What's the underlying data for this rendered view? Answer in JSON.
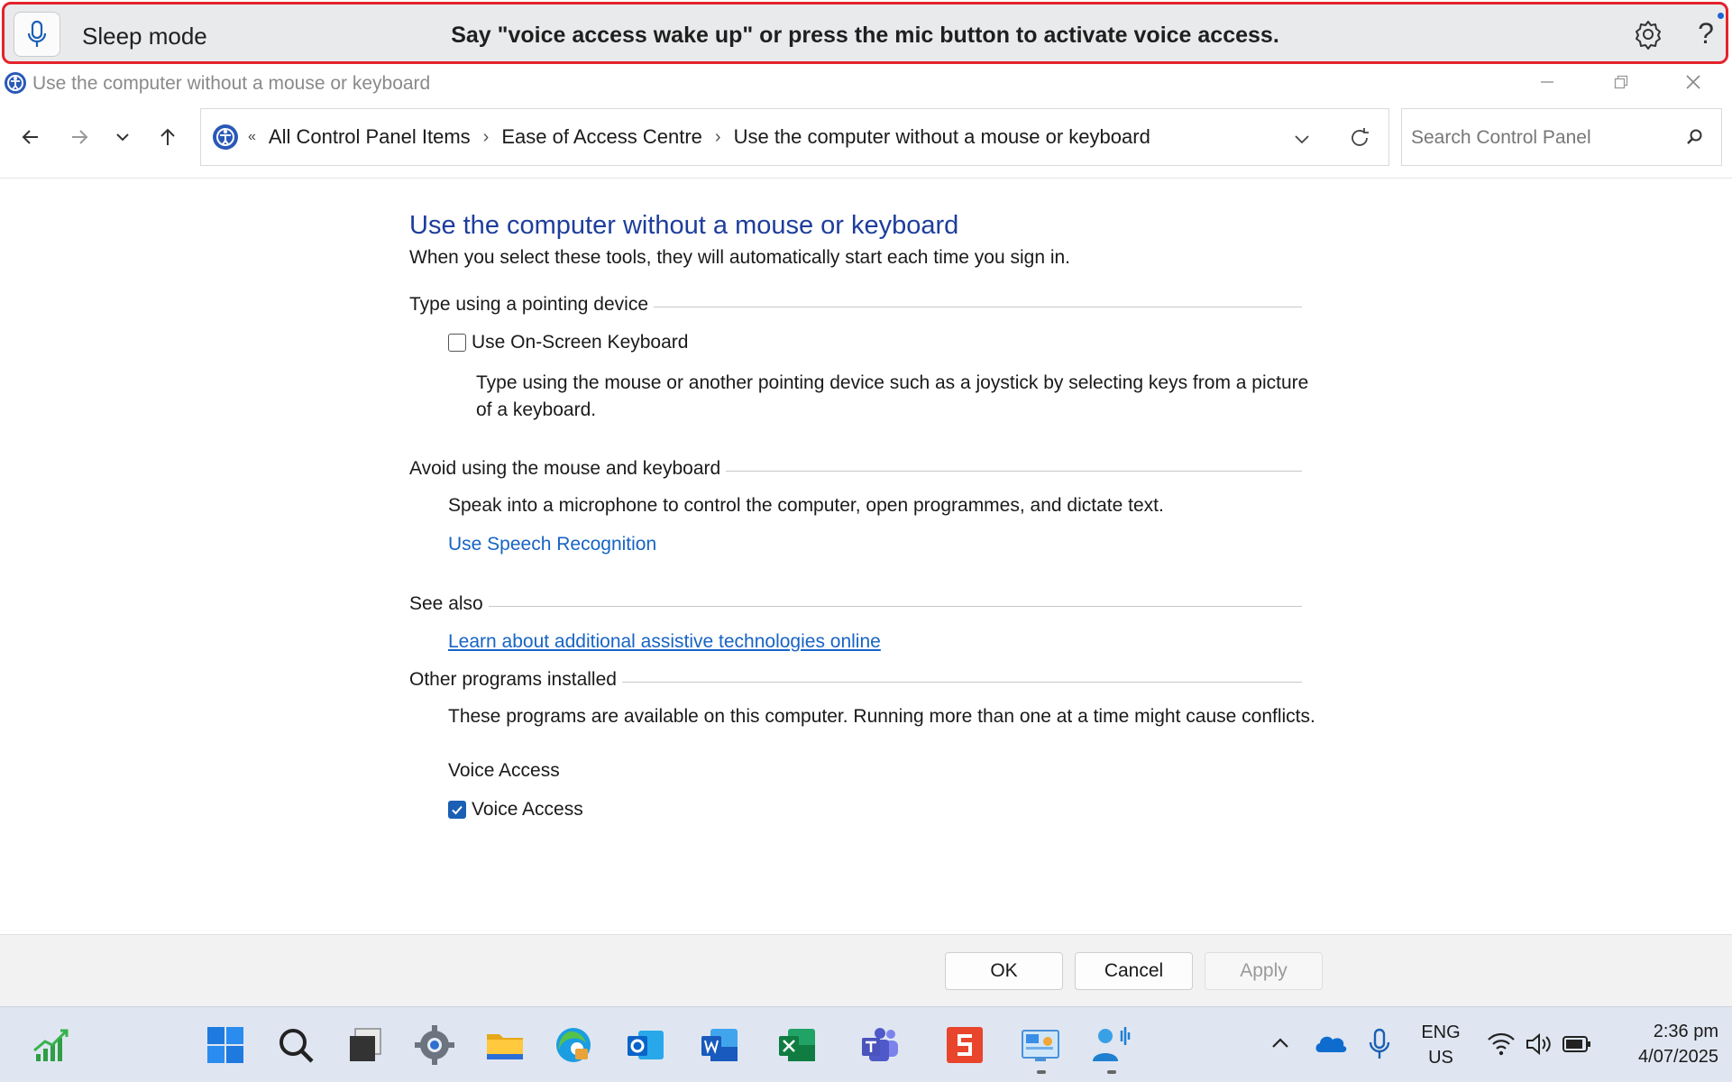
{
  "voice_access": {
    "mode": "Sleep mode",
    "message": "Say \"voice access wake up\" or press the mic button to activate voice access.",
    "help": "?"
  },
  "window": {
    "title": "Use the computer without a mouse or keyboard"
  },
  "address_bar": {
    "overflow": "«",
    "crumbs": [
      "All Control Panel Items",
      "Ease of Access Centre",
      "Use the computer without a mouse or keyboard"
    ],
    "separator": "›"
  },
  "search": {
    "placeholder": "Search Control Panel"
  },
  "content": {
    "title": "Use the computer without a mouse or keyboard",
    "subtitle": "When you select these tools, they will automatically start each time you sign in.",
    "sections": {
      "pointing": {
        "title": "Type using a pointing device",
        "checkbox_label": "Use On-Screen Keyboard",
        "checked": false,
        "description": "Type using the mouse or another pointing device such as a joystick by selecting keys from a picture of a keyboard."
      },
      "avoid": {
        "title": "Avoid using the mouse and keyboard",
        "description": "Speak into a microphone to control the computer, open programmes, and dictate text.",
        "link": "Use Speech Recognition"
      },
      "see_also": {
        "title": "See also",
        "link": "Learn about additional assistive technologies online"
      },
      "other": {
        "title": "Other programs installed",
        "description": "These programs are available on this computer. Running more than one at a time might cause conflicts.",
        "group_label": "Voice Access",
        "checkbox_label": "Voice Access",
        "checked": true
      }
    }
  },
  "buttons": {
    "ok": "OK",
    "cancel": "Cancel",
    "apply": "Apply"
  },
  "taskbar": {
    "language_line1": "ENG",
    "language_line2": "US",
    "time": "2:36 pm",
    "date": "4/07/2025"
  },
  "colors": {
    "accent_blue": "#1764c4",
    "title_blue": "#1e3d9c",
    "highlight_red": "#e3232c"
  }
}
